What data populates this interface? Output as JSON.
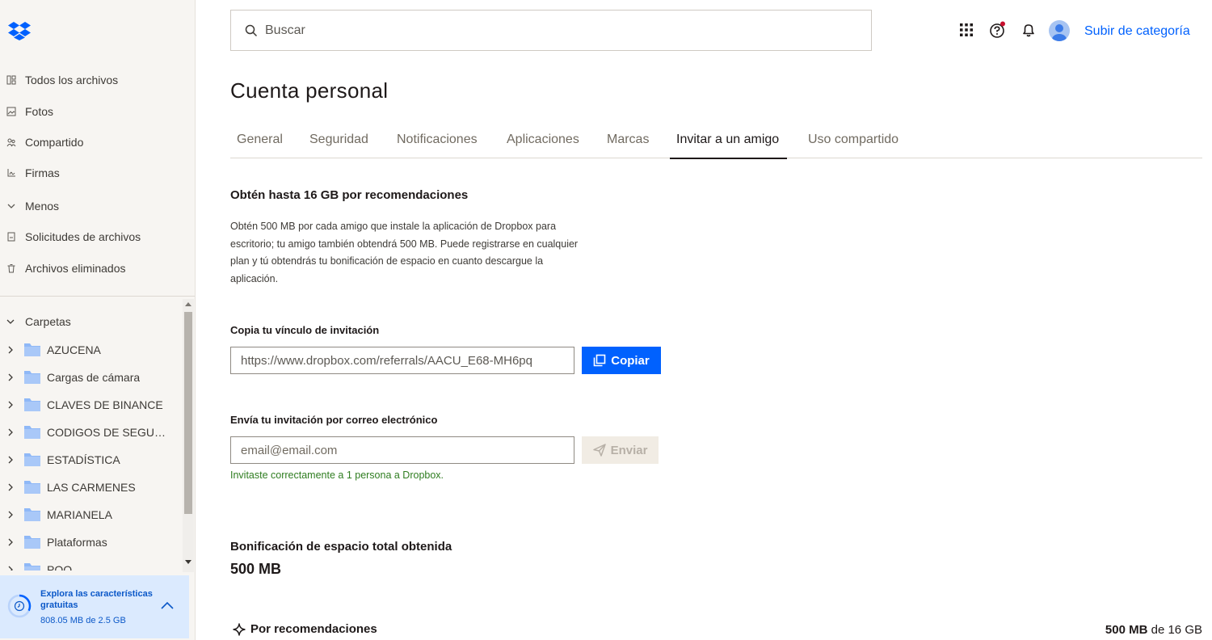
{
  "sidebar": {
    "nav": [
      {
        "label": "Todos los archivos",
        "icon": "all-files-icon"
      },
      {
        "label": "Fotos",
        "icon": "photos-icon"
      },
      {
        "label": "Compartido",
        "icon": "shared-icon"
      },
      {
        "label": "Firmas",
        "icon": "signatures-icon"
      },
      {
        "label": "Menos",
        "icon": "chevron-down-icon"
      },
      {
        "label": "Solicitudes de archivos",
        "icon": "file-requests-icon"
      },
      {
        "label": "Archivos eliminados",
        "icon": "trash-icon"
      }
    ],
    "folders_header": "Carpetas",
    "folders": [
      "AZUCENA",
      "Cargas de cámara",
      "CLAVES DE BINANCE",
      "CODIGOS DE SEGURIDAD",
      "ESTADÍSTICA",
      "LAS CARMENES",
      "MARIANELA",
      "Plataformas",
      "POO"
    ],
    "promo": {
      "title": "Explora las características gratuitas",
      "usage": "808.05 MB de 2.5 GB",
      "usage_fraction": 0.32
    }
  },
  "header": {
    "search_placeholder": "Buscar",
    "upgrade_label": "Subir de categoría",
    "help_has_notification": true
  },
  "page": {
    "title": "Cuenta personal",
    "tabs": [
      {
        "label": "General",
        "active": false
      },
      {
        "label": "Seguridad",
        "active": false
      },
      {
        "label": "Notificaciones",
        "active": false
      },
      {
        "label": "Aplicaciones",
        "active": false
      },
      {
        "label": "Marcas",
        "active": false
      },
      {
        "label": "Invitar a un amigo",
        "active": true
      },
      {
        "label": "Uso compartido",
        "active": false
      }
    ]
  },
  "invite": {
    "heading": "Obtén hasta 16 GB por recomendaciones",
    "description": "Obtén 500 MB por cada amigo que instale la aplicación de Dropbox para escritorio; tu amigo también obtendrá 500 MB. Puede registrarse en cualquier plan y tú obtendrás tu bonificación de espacio en cuanto descargue la aplicación.",
    "link_label": "Copia tu vínculo de invitación",
    "link_value": "https://www.dropbox.com/referrals/AACU_E68-MH6pq",
    "copy_button": "Copiar",
    "email_label": "Envía tu invitación por correo electrónico",
    "email_placeholder": "email@email.com",
    "send_button": "Enviar",
    "success_message": "Invitaste correctamente a 1 persona a Dropbox."
  },
  "bonus": {
    "heading": "Bonificación de espacio total obtenida",
    "total": "500 MB",
    "by_referrals_label": "Por recomendaciones",
    "by_referrals_amount": "500 MB",
    "by_referrals_of": "de 16 GB"
  },
  "colors": {
    "accent": "#0061fe",
    "sidebar_bg": "#f7f5f2",
    "folder_blue": "#8fb8f7",
    "success": "#2f7d20",
    "promo_bg": "#dbeafe"
  }
}
